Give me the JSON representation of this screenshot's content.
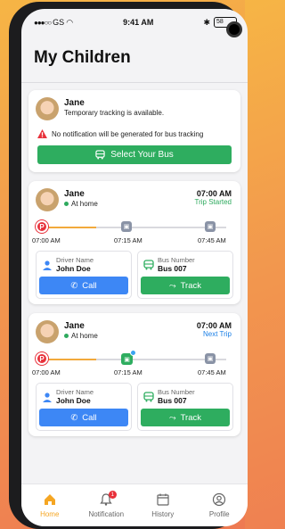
{
  "status_bar": {
    "carrier": "GS",
    "time": "9:41 AM",
    "battery": "58"
  },
  "header": {
    "title": "My Children"
  },
  "cards": [
    {
      "child_name": "Jane",
      "status": "Temporary tracking is available.",
      "warning": "No notification will be generated for bus tracking",
      "select_bus_label": "Select Your Bus"
    },
    {
      "child_name": "Jane",
      "location": "At home",
      "time": "07:00 AM",
      "trip_status": "Trip Started",
      "stop_times": [
        "07:00 AM",
        "07:15 AM",
        "07:45 AM"
      ],
      "progress": 0.3,
      "driver_label": "Driver Name",
      "driver_name": "John Doe",
      "bus_label": "Bus Number",
      "bus_number": "Bus 007",
      "call_label": "Call",
      "track_label": "Track"
    },
    {
      "child_name": "Jane",
      "location": "At home",
      "time": "07:00 AM",
      "trip_status": "Next Trip",
      "stop_times": [
        "07:00 AM",
        "07:15 AM",
        "07:45 AM"
      ],
      "progress": 0.3,
      "driver_label": "Driver Name",
      "driver_name": "John Doe",
      "bus_label": "Bus Number",
      "bus_number": "Bus 007",
      "call_label": "Call",
      "track_label": "Track"
    }
  ],
  "tabs": [
    {
      "label": "Home",
      "icon": "home-icon",
      "active": true
    },
    {
      "label": "Notification",
      "icon": "bell-icon",
      "badge": "1"
    },
    {
      "label": "History",
      "icon": "calendar-icon"
    },
    {
      "label": "Profile",
      "icon": "user-icon"
    }
  ],
  "colors": {
    "accent": "#f5a623",
    "green": "#2ead5f",
    "blue": "#3d87f5",
    "red": "#e8313b"
  }
}
